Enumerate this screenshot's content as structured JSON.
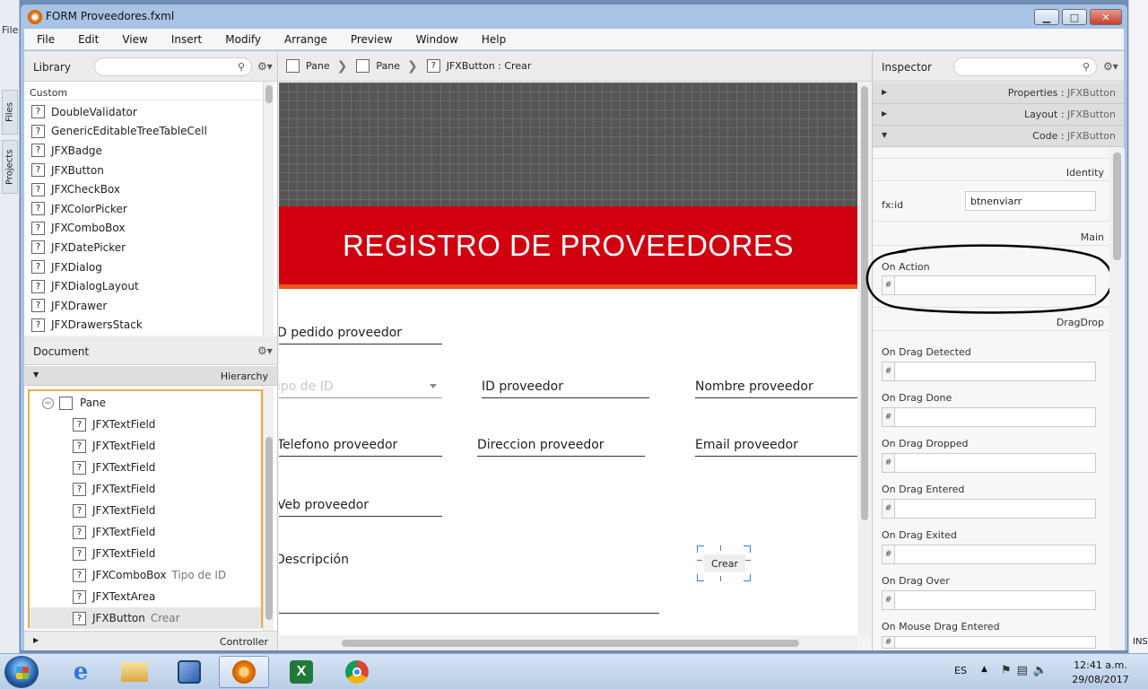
{
  "window": {
    "title": "FORM Proveedores.fxml",
    "btn_min": "▁",
    "btn_max": "□",
    "btn_close": "✕"
  },
  "background_ide": {
    "file_menu": "File",
    "tab_files": "Files",
    "tab_projects": "Projects",
    "right_edge_text": "INS"
  },
  "menu": [
    "File",
    "Edit",
    "View",
    "Insert",
    "Modify",
    "Arrange",
    "Preview",
    "Window",
    "Help"
  ],
  "library": {
    "title": "Library",
    "search_placeholder": "",
    "section": "Custom",
    "items": [
      "DoubleValidator",
      "GenericEditableTreeTableCell",
      "JFXBadge",
      "JFXButton",
      "JFXCheckBox",
      "JFXColorPicker",
      "JFXComboBox",
      "JFXDatePicker",
      "JFXDialog",
      "JFXDialogLayout",
      "JFXDrawer",
      "JFXDrawersStack"
    ]
  },
  "document": {
    "title": "Document",
    "hierarchy_label": "Hierarchy",
    "controller_label": "Controller",
    "tree": [
      {
        "label": "Pane",
        "sub": ""
      },
      {
        "label": "JFXTextField",
        "sub": ""
      },
      {
        "label": "JFXTextField",
        "sub": ""
      },
      {
        "label": "JFXTextField",
        "sub": ""
      },
      {
        "label": "JFXTextField",
        "sub": ""
      },
      {
        "label": "JFXTextField",
        "sub": ""
      },
      {
        "label": "JFXTextField",
        "sub": ""
      },
      {
        "label": "JFXTextField",
        "sub": ""
      },
      {
        "label": "JFXComboBox",
        "sub": "Tipo de ID"
      },
      {
        "label": "JFXTextArea",
        "sub": ""
      },
      {
        "label": "JFXButton",
        "sub": "Crear"
      }
    ]
  },
  "breadcrumb": [
    "Pane",
    "Pane",
    "JFXButton : Crear"
  ],
  "form": {
    "banner": "REGISTRO DE PROVEEDORES",
    "fields": {
      "id_pedido": "D  pedido proveedor",
      "tipo_id": "ipo de ID",
      "id_proveedor": "ID proveedor",
      "nombre": "Nombre proveedor",
      "telefono": "Telefono proveedor",
      "direccion": "Direccion proveedor",
      "email": "Email proveedor",
      "web": "Veb proveedor",
      "descripcion": "Descripción"
    },
    "button": "Crear"
  },
  "inspector": {
    "title": "Inspector",
    "sections": [
      {
        "name": "Properties",
        "target": "JFXButton",
        "expanded": false
      },
      {
        "name": "Layout",
        "target": "JFXButton",
        "expanded": false
      },
      {
        "name": "Code",
        "target": "JFXButton",
        "expanded": true
      }
    ],
    "identity": {
      "header": "Identity",
      "fxid_label": "fx:id",
      "fxid_value": "btnenviarr"
    },
    "main": {
      "header": "Main",
      "on_action_label": "On Action",
      "on_action_value": ""
    },
    "dragdrop": {
      "header": "DragDrop",
      "events": [
        "On Drag Detected",
        "On Drag Done",
        "On Drag Dropped",
        "On Drag Entered",
        "On Drag Exited",
        "On Drag Over",
        "On Mouse Drag Entered"
      ]
    },
    "hash": "#"
  },
  "taskbar": {
    "apps": [
      "start-button",
      "internet-explorer",
      "file-explorer",
      "virtualbox",
      "scene-builder",
      "excel",
      "chrome"
    ],
    "language": "ES",
    "time": "12:41 a.m.",
    "date": "29/08/2017"
  }
}
